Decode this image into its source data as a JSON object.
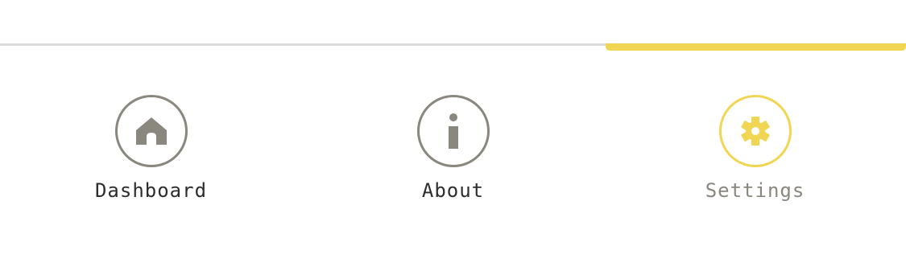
{
  "theme": {
    "accent": "#f1d654",
    "icon_gray": "#8a877f",
    "label_text": "#2d2d2d",
    "inactive_label": "#8a877f",
    "divider": "#dcdcdc"
  },
  "nav": {
    "active_tab": "settings",
    "tabs": [
      {
        "id": "dashboard",
        "label": "Dashboard",
        "icon": "home-icon"
      },
      {
        "id": "about",
        "label": "About",
        "icon": "info-icon"
      },
      {
        "id": "settings",
        "label": "Settings",
        "icon": "gear-icon"
      }
    ]
  }
}
